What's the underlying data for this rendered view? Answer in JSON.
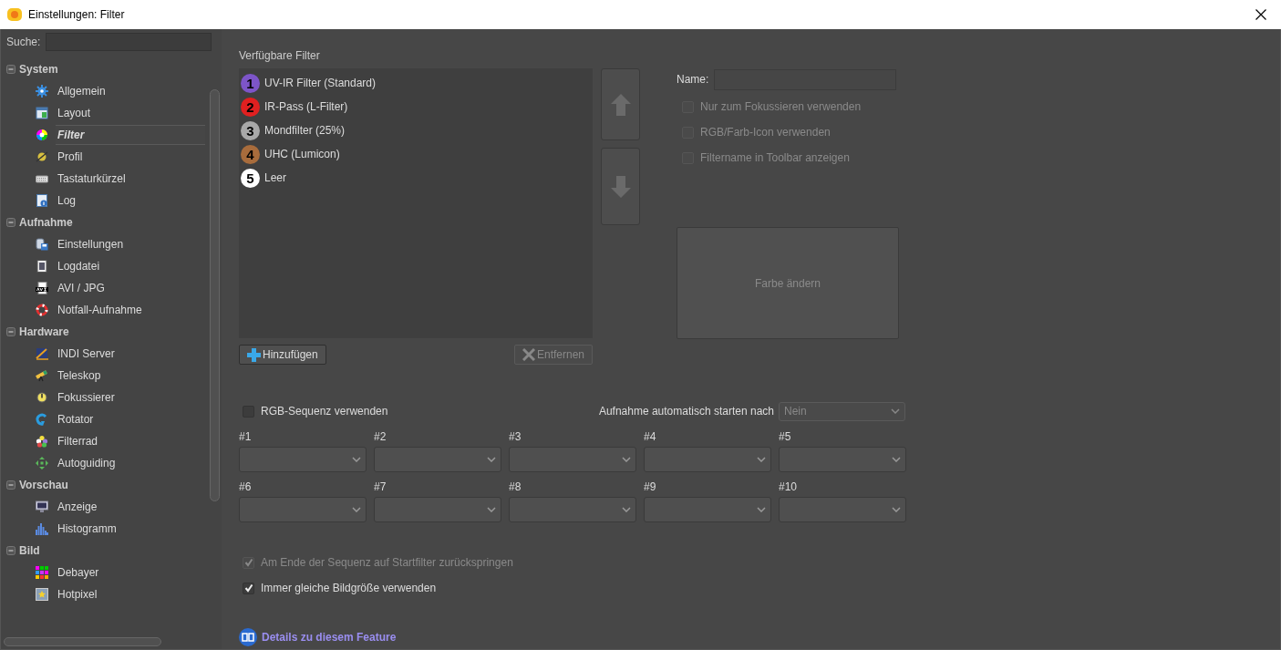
{
  "window": {
    "title": "Einstellungen: Filter"
  },
  "sidebar": {
    "search": {
      "label": "Suche:"
    },
    "groups": [
      {
        "label": "System",
        "expanded": true,
        "children": [
          {
            "label": "Allgemein",
            "selected": false
          },
          {
            "label": "Layout",
            "selected": false
          },
          {
            "label": "Filter",
            "selected": true
          },
          {
            "label": "Profil",
            "selected": false
          },
          {
            "label": "Tastaturkürzel",
            "selected": false
          },
          {
            "label": "Log",
            "selected": false
          }
        ]
      },
      {
        "label": "Aufnahme",
        "expanded": true,
        "children": [
          {
            "label": "Einstellungen",
            "selected": false
          },
          {
            "label": "Logdatei",
            "selected": false
          },
          {
            "label": "AVI / JPG",
            "selected": false
          },
          {
            "label": "Notfall-Aufnahme",
            "selected": false
          }
        ]
      },
      {
        "label": "Hardware",
        "expanded": true,
        "children": [
          {
            "label": "INDI Server",
            "selected": false
          },
          {
            "label": "Teleskop",
            "selected": false
          },
          {
            "label": "Fokussierer",
            "selected": false
          },
          {
            "label": "Rotator",
            "selected": false
          },
          {
            "label": "Filterrad",
            "selected": false
          },
          {
            "label": "Autoguiding",
            "selected": false
          }
        ]
      },
      {
        "label": "Vorschau",
        "expanded": true,
        "children": [
          {
            "label": "Anzeige",
            "selected": false
          },
          {
            "label": "Histogramm",
            "selected": false
          }
        ]
      },
      {
        "label": "Bild",
        "expanded": true,
        "children": [
          {
            "label": "Debayer",
            "selected": false
          },
          {
            "label": "Hotpixel",
            "selected": false
          }
        ]
      }
    ]
  },
  "filters": {
    "title": "Verfügbare Filter",
    "items": [
      {
        "number": "1",
        "name": "UV-IR Filter (Standard)",
        "color": "#7d55c8"
      },
      {
        "number": "2",
        "name": "IR-Pass (L-Filter)",
        "color": "#e02020"
      },
      {
        "number": "3",
        "name": "Mondfilter (25%)",
        "color": "#a8a8a8"
      },
      {
        "number": "4",
        "name": "UHC (Lumicon)",
        "color": "#a86c3c"
      },
      {
        "number": "5",
        "name": "Leer",
        "color": "#ffffff"
      }
    ],
    "add_button": {
      "label": "Hinzufügen",
      "disabled": false
    },
    "remove_button": {
      "label": "Entfernen",
      "disabled": true
    }
  },
  "details": {
    "name_label": "Name:",
    "options": [
      {
        "label": "Nur zum Fokussieren verwenden",
        "checked": false,
        "disabled": true
      },
      {
        "label": "RGB/Farb-Icon verwenden",
        "checked": false,
        "disabled": true
      },
      {
        "label": "Filtername in Toolbar anzeigen",
        "checked": false,
        "disabled": true
      }
    ],
    "color_button": {
      "label": "Farbe ändern",
      "disabled": true
    }
  },
  "sequence": {
    "use_rgb": {
      "label": "RGB-Sequenz verwenden",
      "checked": false,
      "disabled": false
    },
    "autostart": {
      "label": "Aufnahme automatisch starten nach",
      "value": "Nein",
      "disabled": true
    },
    "slots": [
      "#1",
      "#2",
      "#3",
      "#4",
      "#5",
      "#6",
      "#7",
      "#8",
      "#9",
      "#10"
    ],
    "options": [
      {
        "label": "Am Ende der Sequenz auf Startfilter zurückspringen",
        "checked": true,
        "disabled": true
      },
      {
        "label": "Immer gleiche Bildgröße verwenden",
        "checked": true,
        "disabled": false
      }
    ]
  },
  "help_link": "Details zu diesem Feature"
}
